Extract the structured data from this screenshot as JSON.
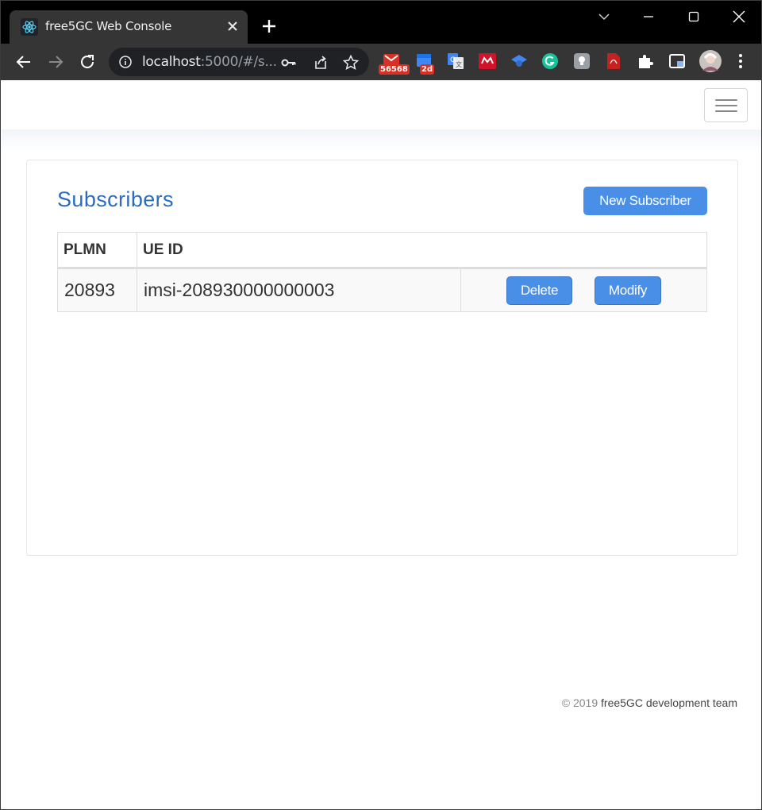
{
  "browser": {
    "tab_title": "free5GC Web Console",
    "url_host": "localhost",
    "url_rest": ":5000/#/s...",
    "extensions": [
      {
        "name": "gmail-extension",
        "badge": "56568",
        "color": "#d93025"
      },
      {
        "name": "calendar-extension",
        "badge": "2d",
        "color": "#d93025"
      },
      {
        "name": "translate-extension"
      },
      {
        "name": "mendeley-extension"
      },
      {
        "name": "scholar-extension"
      },
      {
        "name": "grammarly-extension"
      },
      {
        "name": "keep-extension"
      },
      {
        "name": "pdf-extension"
      },
      {
        "name": "puzzle-extension"
      },
      {
        "name": "sidepanel-extension"
      },
      {
        "name": "profile-avatar"
      }
    ]
  },
  "page": {
    "title": "Subscribers",
    "new_button": "New Subscriber",
    "table": {
      "headers": [
        "PLMN",
        "UE ID"
      ],
      "rows": [
        {
          "plmn": "20893",
          "ue_id": "imsi-208930000000003",
          "delete_label": "Delete",
          "modify_label": "Modify"
        }
      ]
    },
    "footer": {
      "copyright": "© 2019",
      "team": "free5GC development team"
    }
  },
  "colors": {
    "accent": "#4a8fe7",
    "title": "#2a6ebb",
    "chrome_dark": "#353535"
  }
}
